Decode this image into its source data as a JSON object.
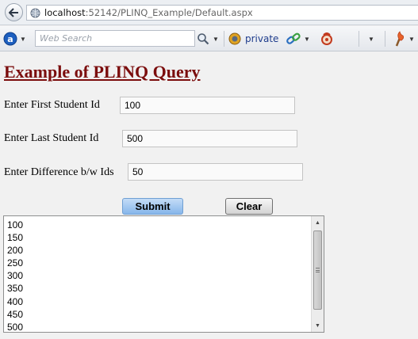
{
  "browser": {
    "url_host": "localhost",
    "url_path": ":52142/PLINQ_Example/Default.aspx",
    "search_placeholder": "Web Search",
    "private_label": "private",
    "icons": [
      "back-arrow-icon",
      "globe-icon",
      "ask-logo-icon",
      "magnifier-icon",
      "private-badge-icon",
      "link-icon",
      "tool-icon",
      "page-menu-icon",
      "fire-tools-icon"
    ]
  },
  "page": {
    "title": "Example of PLINQ Query",
    "fields": [
      {
        "label": "Enter First Student Id",
        "value": "100"
      },
      {
        "label": "Enter Last Student Id",
        "value": "500"
      },
      {
        "label": "Enter Difference b/w Ids",
        "value": "50"
      }
    ],
    "submit_label": "Submit",
    "clear_label": "Clear",
    "results": [
      "100",
      "150",
      "200",
      "250",
      "300",
      "350",
      "400",
      "450",
      "500"
    ]
  },
  "colors": {
    "title": "#7b0d0d",
    "submit_bg": "#9cc3f0",
    "page_bg": "#f1f1f1"
  }
}
